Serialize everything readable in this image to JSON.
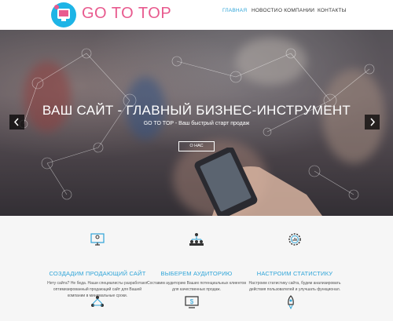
{
  "header": {
    "brand": "GO TO TOP",
    "nav": [
      {
        "label": "ГЛАВНАЯ",
        "active": true
      },
      {
        "label": "НОВОСТИ",
        "active": false
      },
      {
        "label": "О КОМПАНИИ",
        "active": false
      },
      {
        "label": "КОНТАКТЫ",
        "active": false
      }
    ]
  },
  "hero": {
    "title": "ВАШ САЙТ - ГЛАВНЫЙ БИЗНЕС-ИНСТРУМЕНТ",
    "subtitle": "GO TO TOP - Ваш быстрый старт продаж",
    "button_label": "О НАС",
    "prev_icon": "chevron-left-icon",
    "next_icon": "chevron-right-icon"
  },
  "features": [
    {
      "icon": "monitor-pin-icon",
      "title": "СОЗДАДИМ ПРОДАЮЩИЙ САЙТ",
      "text": "Нету сайта? Не беда. Наши специалисты разработают оптимизированный продающий сайт для Вашей компании в минимальные сроки."
    },
    {
      "icon": "audience-icon",
      "title": "ВЫБЕРЕМ АУДИТОРИЮ",
      "text": "Составим аудиторию Ваших потенциальных клиентов для качественных продаж."
    },
    {
      "icon": "gear-stats-icon",
      "title": "НАСТРОИМ СТАТИСТИКУ",
      "text": "Настроим статистику сайта, будем анализировать действия пользователей и улучшать функционал."
    }
  ],
  "features_row2_icons": [
    "network-icon",
    "dollar-monitor-icon",
    "rocket-icon"
  ],
  "colors": {
    "accent": "#2ea4d8",
    "brand": "#e85a8e",
    "logo_circle": "#1db4e6"
  }
}
